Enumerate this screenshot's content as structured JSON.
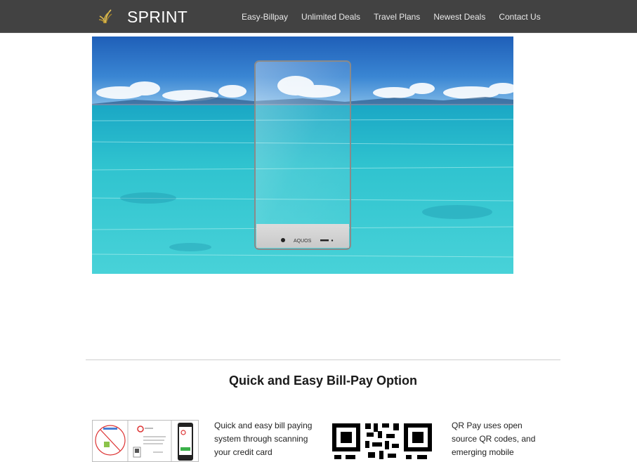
{
  "brand": {
    "name": "SPRINT",
    "logo_icon": "sprint-logo-icon"
  },
  "nav": {
    "items": [
      {
        "label": "Easy-Billpay"
      },
      {
        "label": "Unlimited Deals"
      },
      {
        "label": "Travel Plans"
      },
      {
        "label": "Newest Deals"
      },
      {
        "label": "Contact Us"
      }
    ]
  },
  "hero": {
    "phone_brand": "AQUOS"
  },
  "section": {
    "title": "Quick and Easy Bill-Pay Option"
  },
  "features": [
    {
      "text": "Quick and easy bill paying system through scanning your credit card"
    },
    {
      "text": "QR Pay uses open source QR codes, and emerging mobile"
    }
  ],
  "colors": {
    "navbar_bg": "#424242",
    "sea": "#2fc3cf",
    "sky": "#2a6fc0"
  }
}
